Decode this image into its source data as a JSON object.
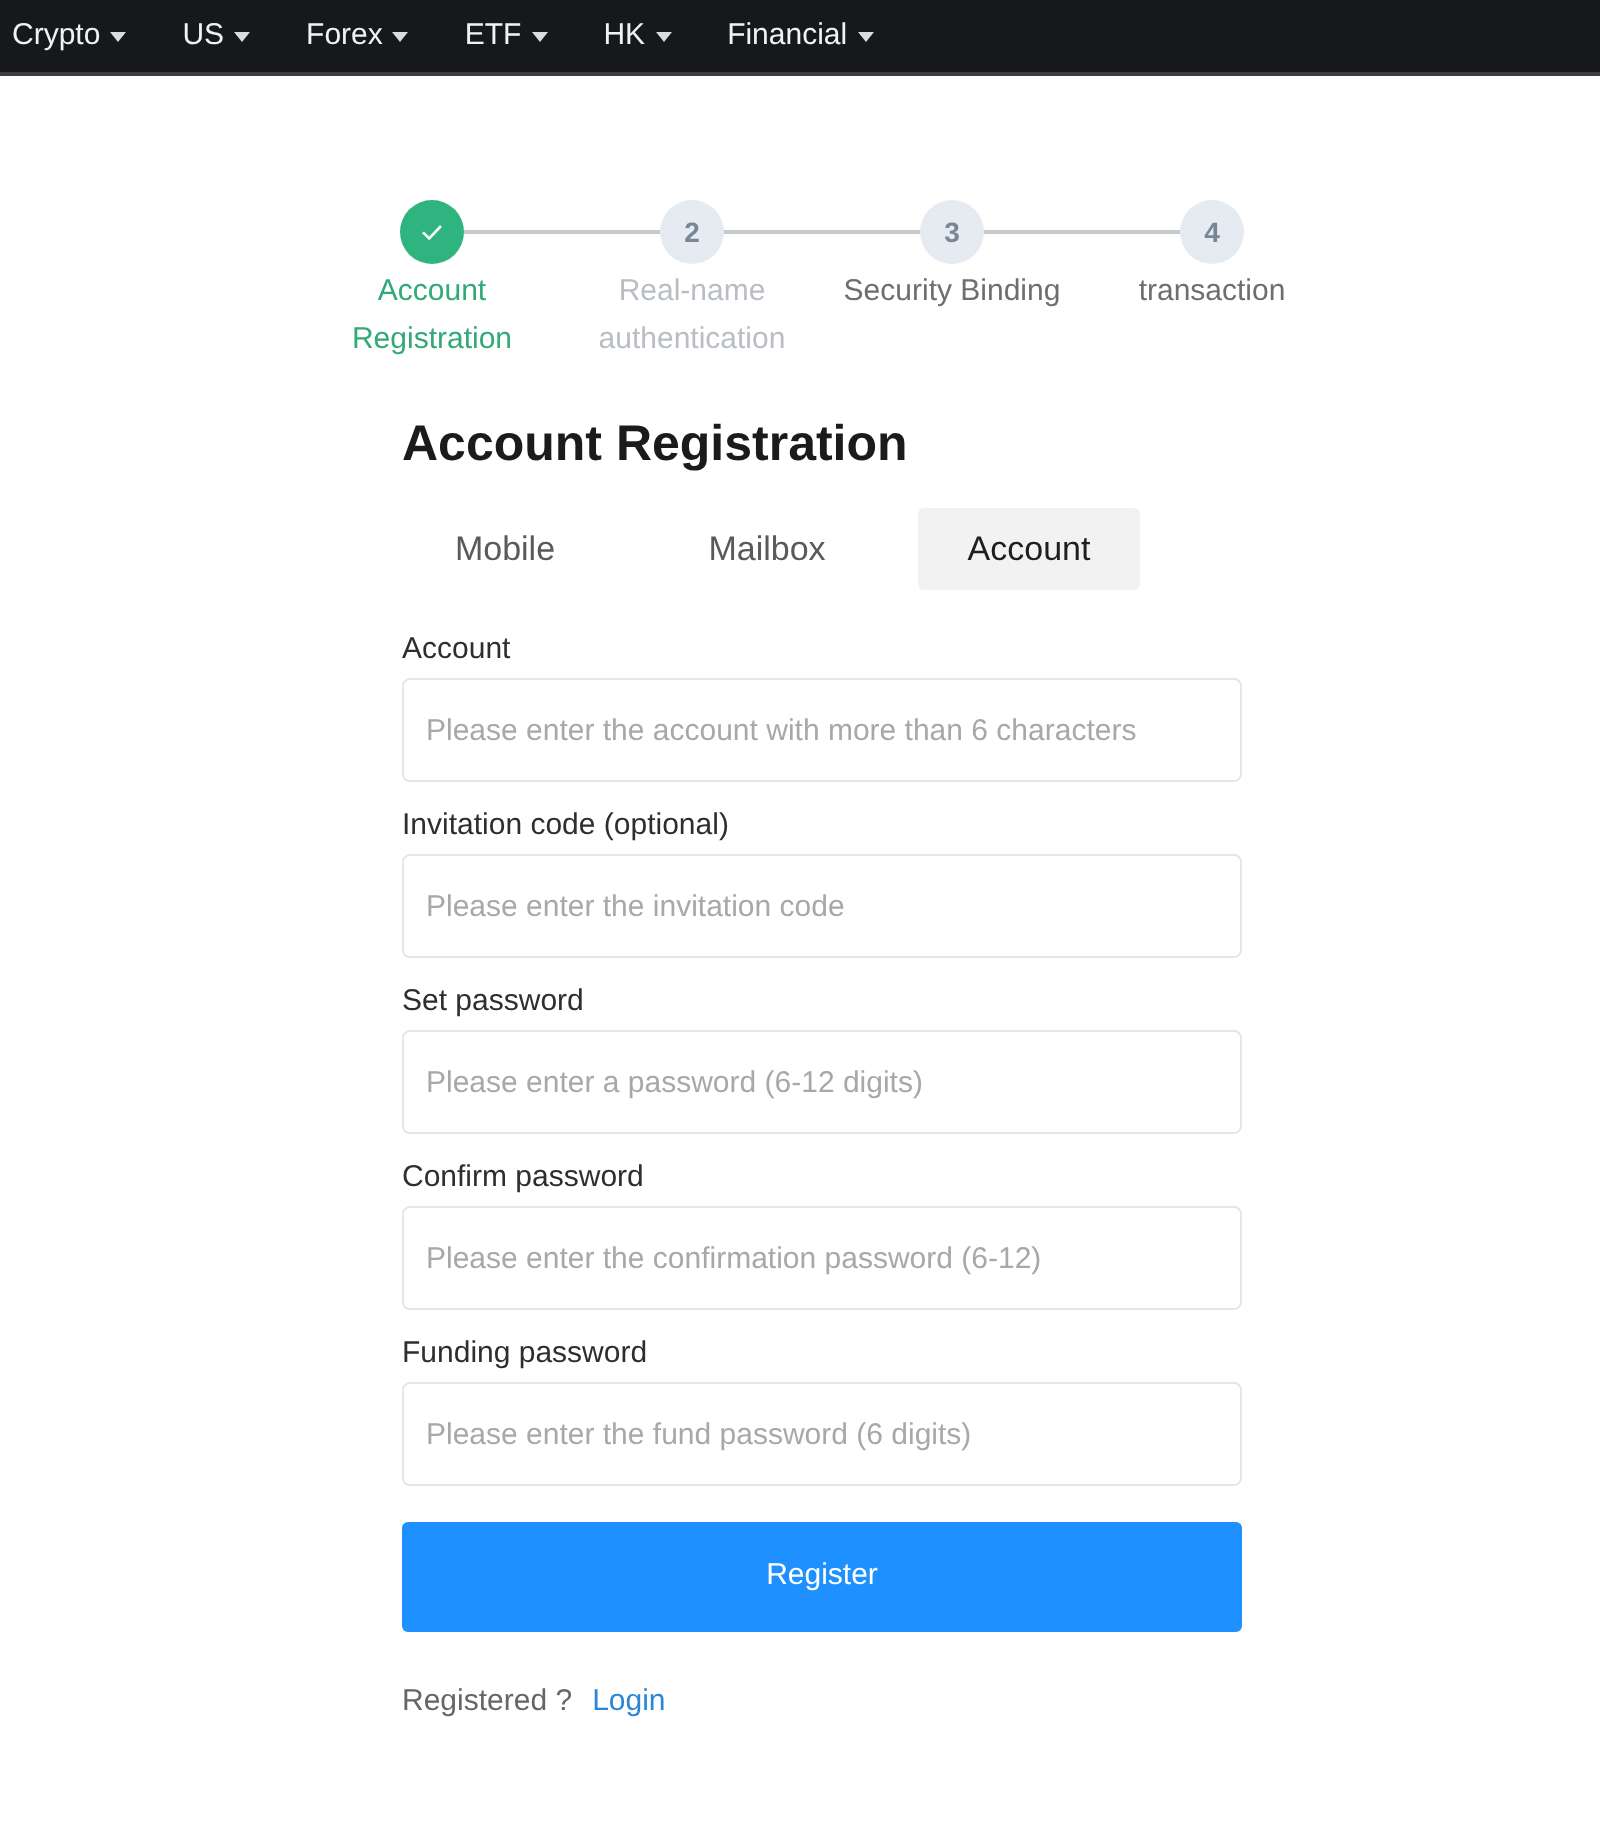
{
  "nav": {
    "items": [
      {
        "label": "Crypto"
      },
      {
        "label": "US"
      },
      {
        "label": "Forex"
      },
      {
        "label": "ETF"
      },
      {
        "label": "HK"
      },
      {
        "label": "Financial"
      }
    ]
  },
  "steps": [
    {
      "label": "Account Registration",
      "completed": true,
      "disabled": false
    },
    {
      "number": "2",
      "label": "Real-name authentication",
      "completed": false,
      "disabled": true
    },
    {
      "number": "3",
      "label": "Security Binding",
      "completed": false,
      "disabled": false
    },
    {
      "number": "4",
      "label": "transaction",
      "completed": false,
      "disabled": false
    }
  ],
  "title": "Account Registration",
  "tabs": [
    {
      "label": "Mobile",
      "selected": false
    },
    {
      "label": "Mailbox",
      "selected": false
    },
    {
      "label": "Account",
      "selected": true
    }
  ],
  "fields": [
    {
      "label": "Account",
      "placeholder": "Please enter the account with more than 6 characters"
    },
    {
      "label": "Invitation code (optional)",
      "placeholder": "Please enter the invitation code"
    },
    {
      "label": "Set password",
      "placeholder": "Please enter a password (6-12 digits)"
    },
    {
      "label": "Confirm password",
      "placeholder": "Please enter the confirmation password (6-12)"
    },
    {
      "label": "Funding password",
      "placeholder": "Please enter the fund password (6 digits)"
    }
  ],
  "submit": {
    "label": "Register"
  },
  "footer": {
    "prompt": "Registered ?",
    "link": "Login"
  }
}
